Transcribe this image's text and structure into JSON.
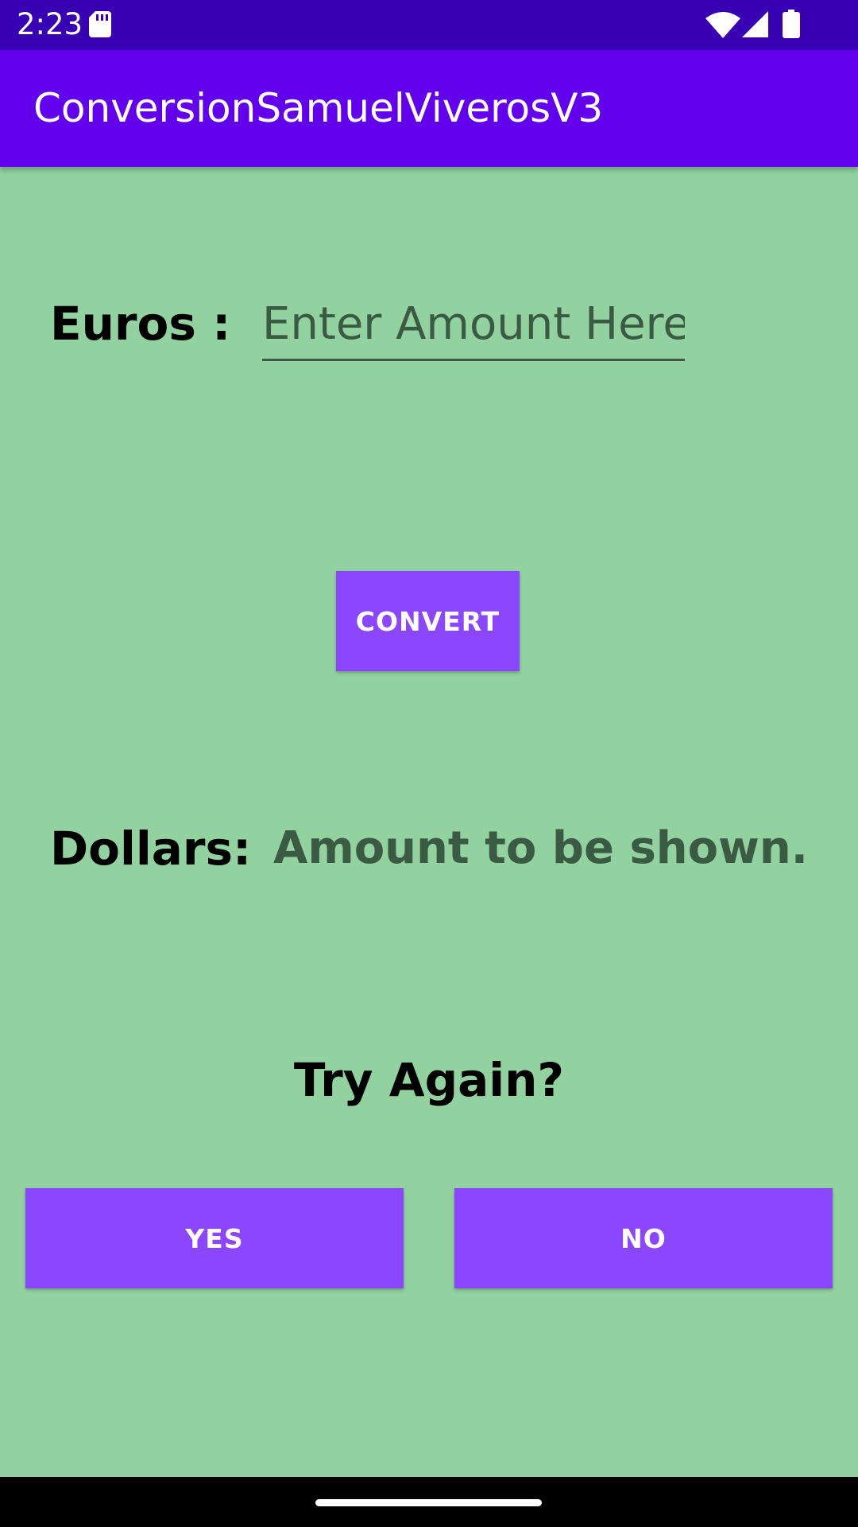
{
  "status_bar": {
    "time": "2:23",
    "icons": [
      "sd-card-icon",
      "wifi-icon",
      "signal-icon",
      "battery-icon"
    ],
    "background": "#3700b3"
  },
  "app_bar": {
    "title": "ConversionSamuelViverosV3",
    "background": "#6200ee"
  },
  "form": {
    "euros_label": "Euros :",
    "amount_placeholder": "Enter Amount Here",
    "amount_value": "",
    "convert_label": "CONVERT",
    "dollars_label": "Dollars:",
    "dollars_value": "Amount to be shown."
  },
  "retry": {
    "prompt": "Try Again?",
    "yes_label": "YES",
    "no_label": "NO"
  },
  "colors": {
    "screen_background": "#92d2a0",
    "button": "#8a47ff",
    "muted_text": "#3b5a42"
  }
}
